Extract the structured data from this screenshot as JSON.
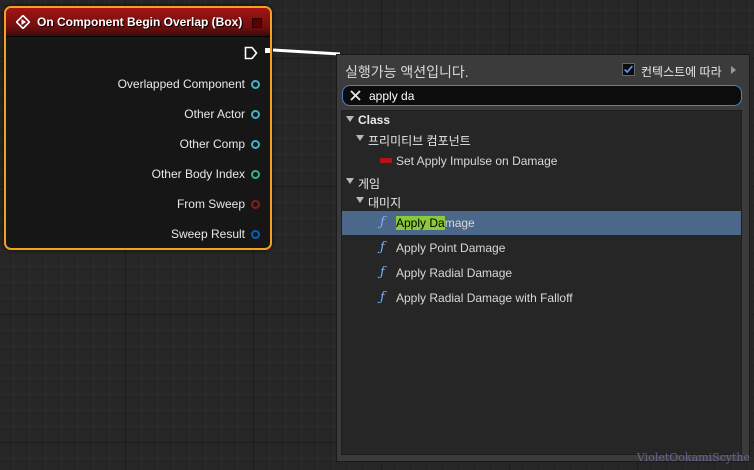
{
  "node": {
    "title": "On Component Begin Overlap (Box)",
    "header_color": "#a31414",
    "border_color": "#f4a020",
    "pins": [
      {
        "label": "Overlapped Component",
        "color": "#3fb3c9"
      },
      {
        "label": "Other Actor",
        "color": "#3fb3c9"
      },
      {
        "label": "Other Comp",
        "color": "#3fb3c9"
      },
      {
        "label": "Other Body Index",
        "color": "#2fb58a"
      },
      {
        "label": "From Sweep",
        "color": "#8c1a1a"
      },
      {
        "label": "Sweep Result",
        "color": "#0a5cc0"
      }
    ]
  },
  "menu": {
    "title": "실행가능 액션입니다.",
    "context_label": "컨텍스트에 따라",
    "context_checked": true,
    "search_value": "apply da",
    "categories": [
      {
        "label": "Class",
        "subcategories": [
          {
            "label": "프리미티브 컴포넌트",
            "actions": [
              {
                "label": "Set Apply Impulse on Damage",
                "icon": "variable-icon"
              }
            ]
          }
        ]
      },
      {
        "label": "게임",
        "subcategories": [
          {
            "label": "대미지",
            "actions": [
              {
                "label": "Apply Damage",
                "icon": "function-icon",
                "selected": true,
                "highlight": "Apply Da",
                "rest": "mage"
              },
              {
                "label": "Apply Point Damage",
                "icon": "function-icon"
              },
              {
                "label": "Apply Radial Damage",
                "icon": "function-icon"
              },
              {
                "label": "Apply Radial Damage with Falloff",
                "icon": "function-icon"
              }
            ]
          }
        ]
      }
    ]
  },
  "watermark": "VioletOokamiScythe",
  "colors": {
    "accent": "#4b7fcf",
    "selection": "#4b6789",
    "highlight": "#8bc83a"
  }
}
